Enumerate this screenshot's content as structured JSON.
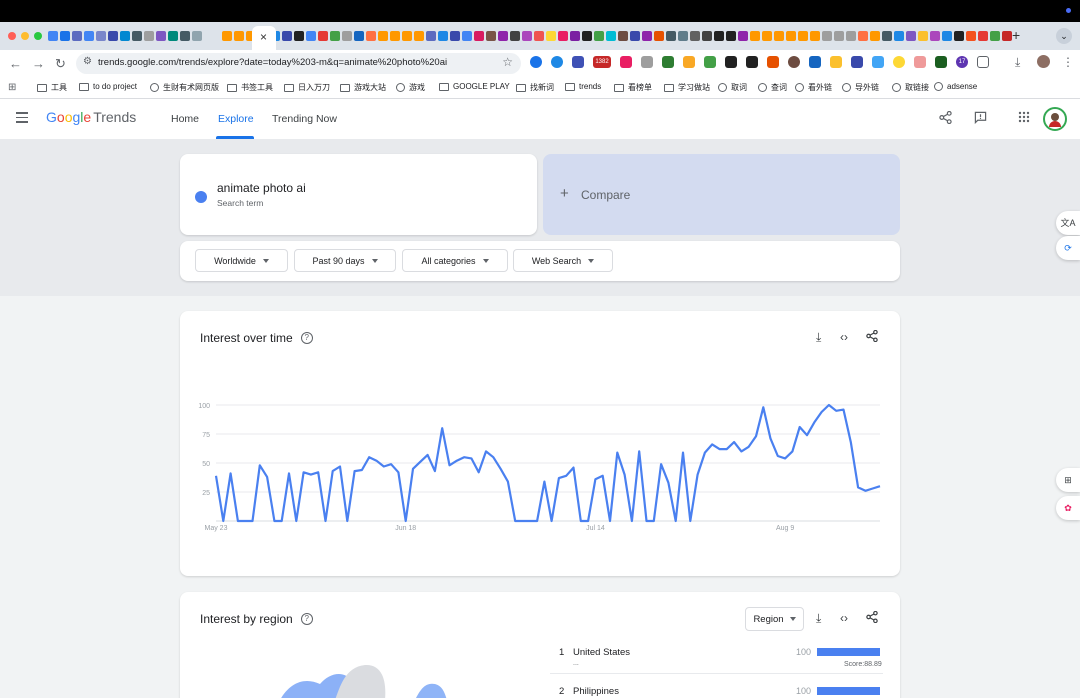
{
  "browser": {
    "url": "trends.google.com/trends/explore?date=today%203-m&q=animate%20photo%20ai",
    "new_tab_symbol": "+",
    "close_symbol": "×",
    "bookmarks": [
      {
        "label": "工具",
        "icon": "folder-icon"
      },
      {
        "label": "to do project",
        "icon": "folder-icon"
      },
      {
        "label": "生财有术网页版",
        "icon": "globe-icon"
      },
      {
        "label": "书签工具",
        "icon": "folder-icon"
      },
      {
        "label": "日入万刀",
        "icon": "folder-icon"
      },
      {
        "label": "游戏大站",
        "icon": "folder-icon"
      },
      {
        "label": "游戏",
        "icon": "globe-icon"
      },
      {
        "label": "GOOGLE PLAY",
        "icon": "folder-icon"
      },
      {
        "label": "找新词",
        "icon": "folder-icon"
      },
      {
        "label": "trends",
        "icon": "folder-icon"
      },
      {
        "label": "看榜单",
        "icon": "folder-icon"
      },
      {
        "label": "学习做站",
        "icon": "folder-icon"
      },
      {
        "label": "取词",
        "icon": "globe-icon"
      },
      {
        "label": "查词",
        "icon": "globe-icon"
      },
      {
        "label": "看外链",
        "icon": "globe-icon"
      },
      {
        "label": "导外链",
        "icon": "globe-icon"
      },
      {
        "label": "取链接",
        "icon": "globe-icon"
      },
      {
        "label": "adsense",
        "icon": "globe-icon"
      }
    ],
    "extension_badge": "17",
    "extension_badge2": "1382"
  },
  "header": {
    "logo_google": "Google",
    "logo_trends": "Trends",
    "nav": [
      "Home",
      "Explore",
      "Trending Now"
    ],
    "active_nav": "Explore"
  },
  "search": {
    "term": "animate photo ai",
    "term_sub": "Search term",
    "compare_label": "Compare",
    "compare_plus": "+",
    "filters": [
      "Worldwide",
      "Past 90 days",
      "All categories",
      "Web Search"
    ]
  },
  "interest_over_time": {
    "title": "Interest over time",
    "help": "?"
  },
  "chart_data": {
    "type": "line",
    "title": "Interest over time",
    "xlabel": "",
    "ylabel": "",
    "ylim": [
      0,
      100
    ],
    "yticks": [
      25,
      50,
      75,
      100
    ],
    "xtick_labels": [
      "May 23",
      "Jun 18",
      "Jul 14",
      "Aug 9"
    ],
    "xtick_index": [
      0,
      26,
      52,
      78
    ],
    "grid": true,
    "series": [
      {
        "color": "#4a80f0",
        "values": [
          39,
          0,
          41,
          0,
          0,
          0,
          48,
          38,
          0,
          0,
          41,
          0,
          42,
          40,
          42,
          0,
          43,
          47,
          0,
          43,
          44,
          55,
          52,
          47,
          49,
          42,
          0,
          45,
          51,
          57,
          43,
          80,
          48,
          52,
          55,
          54,
          42,
          60,
          55,
          45,
          34,
          0,
          0,
          0,
          0,
          34,
          0,
          37,
          39,
          46,
          0,
          0,
          36,
          39,
          0,
          59,
          40,
          0,
          60,
          0,
          0,
          49,
          33,
          0,
          59,
          0,
          40,
          59,
          66,
          62,
          62,
          68,
          60,
          64,
          73,
          98,
          71,
          56,
          54,
          60,
          81,
          74,
          85,
          94,
          100,
          95,
          96,
          68,
          29,
          26,
          28,
          30
        ]
      }
    ]
  },
  "interest_by_region": {
    "title": "Interest by region",
    "help": "?",
    "select_label": "Region",
    "rows": [
      {
        "rank": "1",
        "name": "United States",
        "value": "100",
        "fill": 1.0,
        "score": "Score:88.89",
        "sub": "..."
      },
      {
        "rank": "2",
        "name": "Philippines",
        "value": "100",
        "fill": 1.0
      }
    ]
  },
  "colors": {
    "accent": "#1a73e8",
    "series": "#4a80f0",
    "compare_bg": "#d3dbf0"
  }
}
